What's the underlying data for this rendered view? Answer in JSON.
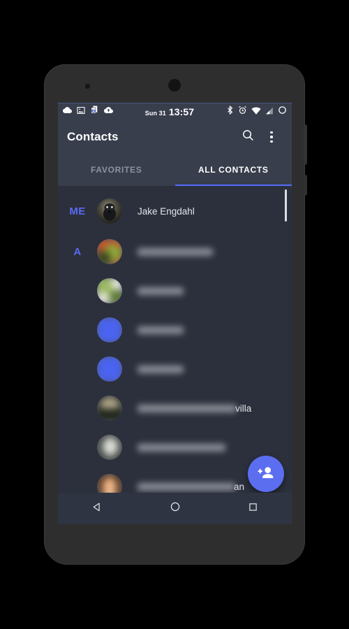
{
  "device": {
    "frame_color": "#2e2e2f",
    "screen_bg": "#2b303c"
  },
  "status_bar": {
    "date": "Sun 31",
    "time": "13:57",
    "left_icons": [
      {
        "name": "cloud-icon"
      },
      {
        "name": "image-icon"
      },
      {
        "name": "documents-badge-icon",
        "badge": "2"
      },
      {
        "name": "cloud-upload-icon"
      }
    ],
    "right_icons": [
      {
        "name": "bluetooth-icon"
      },
      {
        "name": "alarm-icon"
      },
      {
        "name": "wifi-icon"
      },
      {
        "name": "cell-signal-icon"
      },
      {
        "name": "battery-icon"
      }
    ],
    "background": "#383e4c"
  },
  "app_bar": {
    "title": "Contacts",
    "search_label": "Search",
    "overflow_label": "More options",
    "background": "#383e4c"
  },
  "tabs": {
    "accent": "#536dfe",
    "items": [
      {
        "label": "FAVORITES",
        "active": false
      },
      {
        "label": "ALL CONTACTS",
        "active": true
      }
    ]
  },
  "list": {
    "sections": [
      {
        "letter": "ME"
      },
      {
        "letter": "A"
      }
    ],
    "rows": [
      {
        "section": "ME",
        "name": "Jake Engdahl",
        "redacted": false,
        "avatar_colors": [
          "#8a8472",
          "#2a2b27",
          "#121210"
        ]
      },
      {
        "section": "A",
        "name": "",
        "redacted": true,
        "redacted_width": 108,
        "tail": "",
        "avatar_colors": [
          "#c6512a",
          "#8fa83a",
          "#3c4a1e"
        ]
      },
      {
        "section": "",
        "name": "",
        "redacted": true,
        "redacted_width": 66,
        "tail": "",
        "avatar_colors": [
          "#e3e6dc",
          "#9ab85a",
          "#5d7a33"
        ]
      },
      {
        "section": "",
        "name": "",
        "redacted": true,
        "redacted_width": 66,
        "tail": "",
        "avatar_colors": [
          "#4a63f0",
          "#4a63f0",
          "#3d56e8"
        ]
      },
      {
        "section": "",
        "name": "",
        "redacted": true,
        "redacted_width": 66,
        "tail": "",
        "avatar_colors": [
          "#4a63f0",
          "#4a63f0",
          "#3d56e8"
        ]
      },
      {
        "section": "",
        "name": "",
        "redacted": true,
        "redacted_width": 140,
        "tail": "villa",
        "avatar_colors": [
          "#b6a98d",
          "#60604a",
          "#1e2318"
        ]
      },
      {
        "section": "",
        "name": "",
        "redacted": true,
        "redacted_width": 126,
        "tail": "",
        "avatar_colors": [
          "#d6d8d2",
          "#9a9c94",
          "#4c4f48"
        ]
      },
      {
        "section": "",
        "name": "",
        "redacted": true,
        "redacted_width": 140,
        "tail": "an",
        "avatar_colors": [
          "#f0b386",
          "#d88c55",
          "#7a4724"
        ]
      }
    ],
    "section_color": "#5a6bf0",
    "scrollbar_visible": true
  },
  "fab": {
    "icon": "person-add-icon",
    "label": "Add contact",
    "color": "#5b6ef0"
  },
  "nav_bar": {
    "buttons": [
      {
        "name": "back-button",
        "icon": "triangle-left-icon"
      },
      {
        "name": "home-button",
        "icon": "circle-icon"
      },
      {
        "name": "recents-button",
        "icon": "square-icon"
      }
    ],
    "background": "#2f3442"
  }
}
